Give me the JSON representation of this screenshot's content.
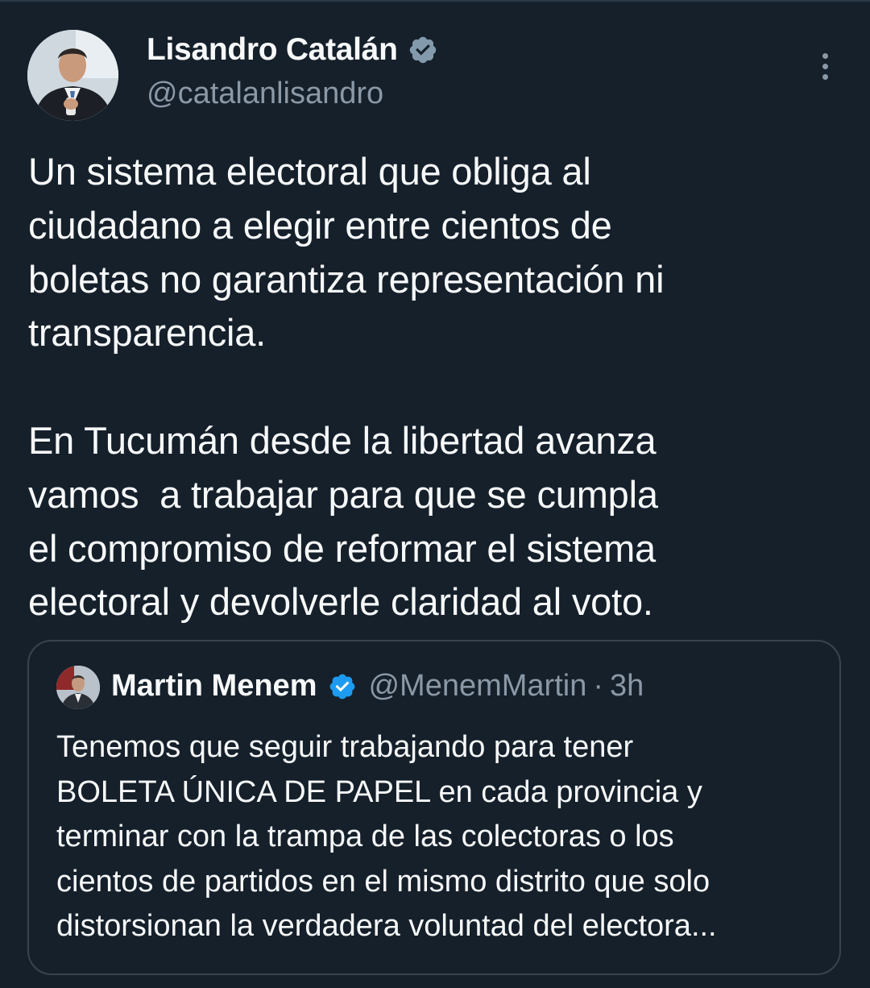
{
  "tweet": {
    "author": {
      "name": "Lisandro Catalán",
      "handle": "@catalanlisandro",
      "avatar_icon": "profile-photo",
      "verified_icon": "verified-badge-icon"
    },
    "more_icon": "more-options-icon",
    "text": "Un sistema electoral que obliga al\nciudadano a elegir entre cientos de\nboletas no garantiza representación ni\ntransparencia.\n\nEn Tucumán desde la libertad avanza\nvamos  a trabajar para que se cumpla\nel compromiso de reformar el sistema\nelectoral y devolverle claridad al voto."
  },
  "quoted_tweet": {
    "author": {
      "name": "Martin Menem",
      "handle": "@MenemMartin",
      "separator": "·",
      "time": "3h",
      "avatar_icon": "profile-photo",
      "verified_icon": "verified-badge-icon"
    },
    "text": "Tenemos que seguir trabajando para tener\nBOLETA ÚNICA DE PAPEL en cada provincia y\nterminar con la trampa de las colectoras o los\ncientos de partidos en el mismo distrito que solo\ndistorsionan la verdadera voluntad del electora..."
  },
  "colors": {
    "background": "#15202b",
    "text_primary": "#f7f9f9",
    "text_secondary": "#8b98a5",
    "border": "#38444d",
    "verified_gray": "#829aab",
    "verified_blue": "#1d9bf0"
  }
}
